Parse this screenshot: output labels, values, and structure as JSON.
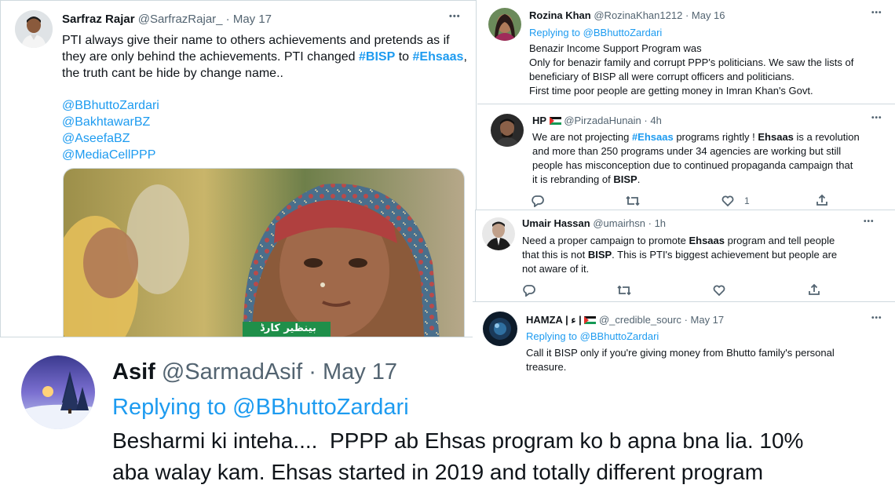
{
  "tweets": {
    "sarfraz": {
      "name": "Sarfraz Rajar",
      "handle": "@SarfrazRajar_",
      "date": "· May 17",
      "line1": "PTI always give their name to others achievements and pretends as if",
      "line2a": "they are only behind the achievements. PTI changed ",
      "tag_bisp": "#BISP",
      "line2b": " to ",
      "tag_ehsaas": "#Ehsaas",
      "line2c": ",",
      "line3": "the truth cant be hide by change name..",
      "mentions": [
        "@BBhuttoZardari",
        "@BakhtawarBZ",
        "@AseefaBZ",
        "@MediaCellPPP"
      ],
      "image_caption": "بینظیر کارڈ"
    },
    "rozina": {
      "name": "Rozina Khan",
      "handle": "@RozinaKhan1212",
      "date": "· May 16",
      "replying": "Replying to ",
      "reply_handle": "@BBhuttoZardari",
      "lines": [
        "Benazir Income Support Program was",
        "Only for benazir family and corrupt PPP's politicians. We saw the lists of",
        "beneficiary of BISP all were corrupt officers and politicians.",
        "First time poor people are getting money in Imran Khan's Govt."
      ]
    },
    "hp": {
      "name": "HP",
      "handle": "@PirzadaHunain",
      "date": "· 4h",
      "l1a": "We are not projecting ",
      "l1tag": "#Ehsaas",
      "l1b": " programs rightly ! ",
      "l1bold": "Ehsaas",
      "l1c": " is a revolution",
      "l2": "and more than 250 programs under 34 agencies are working but still",
      "l3": "people has misconception due to continued propaganda campaign that",
      "l4a": "it is rebranding of ",
      "l4bold": "BISP",
      "l4b": ".",
      "like_count": "1"
    },
    "umair": {
      "name": "Umair Hassan",
      "handle": "@umairhsn",
      "date": "· 1h",
      "l1a": "Need a proper campaign to promote ",
      "l1bold": "Ehsaas",
      "l1b": " program and tell people",
      "l2a": "that this is not ",
      "l2bold": "BISP",
      "l2b": ". This is PTI's biggest achievement but people are",
      "l3": "not aware of it."
    },
    "hamza": {
      "name": "HAMZA | ء |",
      "handle": "@_credible_sourc",
      "date": "· May 17",
      "replying": "Replying to ",
      "reply_handle": "@BBhuttoZardari",
      "l1": "Call it BISP only if you're giving money from Bhutto family's personal",
      "l2": "treasure."
    },
    "asif": {
      "name": "Asif",
      "handle": "@SarmadAsif",
      "date": "· May 17",
      "replying": "Replying to ",
      "reply_handle": "@BBhuttoZardari",
      "l1": "Besharmi ki inteha....  PPPP ab Ehsas program ko b apna bna lia. 10%",
      "l2": "aba walay kam. Ehsas started in 2019 and totally different program"
    }
  },
  "more_label": "•••",
  "colors": {
    "link": "#1d9bf0",
    "muted": "#536471",
    "text": "#0f1419",
    "divider": "#cfd9de"
  }
}
